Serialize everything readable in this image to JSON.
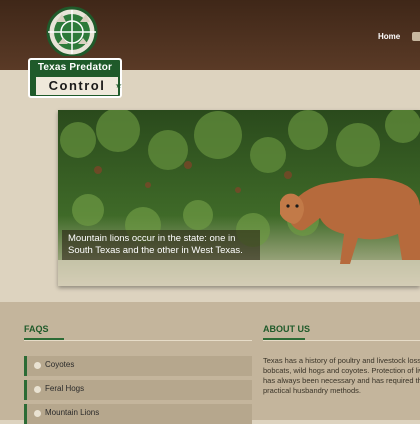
{
  "nav": {
    "home": "Home"
  },
  "logo": {
    "line1": "Texas Predator",
    "line2": "Control"
  },
  "hero": {
    "caption": "Mountain lions occur in the state: one in South Texas and the other in West Texas."
  },
  "faqs": {
    "title": "FAQS",
    "items": [
      {
        "label": "Coyotes"
      },
      {
        "label": "Feral Hogs"
      },
      {
        "label": "Mountain Lions"
      }
    ]
  },
  "about": {
    "title": "ABOUT US",
    "lines": [
      "Texas has a history of poultry and livestock losse",
      "bobcats, wild hogs and coyotes. Protection of liv",
      "has always been necessary and has required the",
      "practical husbandry methods."
    ]
  },
  "colors": {
    "header": "#4a2f1e",
    "accent_green": "#2c6b35",
    "background": "#ddd3bf"
  }
}
